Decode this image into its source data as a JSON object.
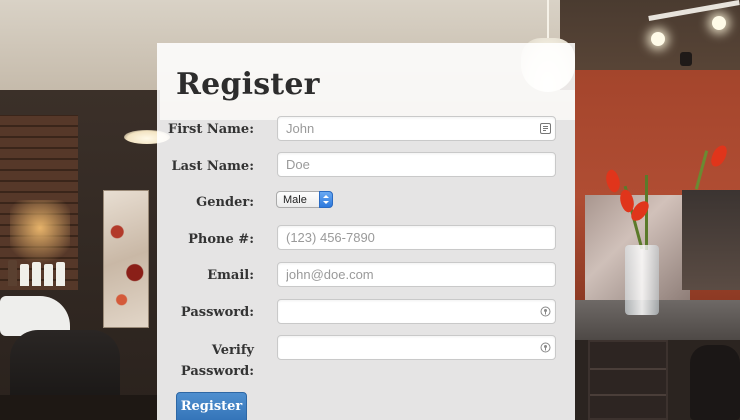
{
  "form": {
    "title": "Register",
    "fields": {
      "first_name": {
        "label": "First Name:",
        "placeholder": "John",
        "value": ""
      },
      "last_name": {
        "label": "Last Name:",
        "placeholder": "Doe",
        "value": ""
      },
      "gender": {
        "label": "Gender:",
        "selected": "Male"
      },
      "phone": {
        "label": "Phone #:",
        "placeholder": "(123) 456-7890",
        "value": ""
      },
      "email": {
        "label": "Email:",
        "placeholder": "john@doe.com",
        "value": ""
      },
      "password": {
        "label": "Password:",
        "placeholder": "",
        "value": ""
      },
      "verify_password": {
        "label_line1": "Verify",
        "label_line2": "Password:",
        "placeholder": "",
        "value": ""
      }
    },
    "submit_label": "Register"
  },
  "icons": {
    "first_name_field": "contact-card-icon",
    "password_field": "key-icon",
    "verify_password_field": "key-icon",
    "gender_select": "stepper-arrows-icon"
  },
  "colors": {
    "button": "#3a7bbf",
    "select_arrow": "#2d79dd",
    "panel": "#ffffff"
  }
}
